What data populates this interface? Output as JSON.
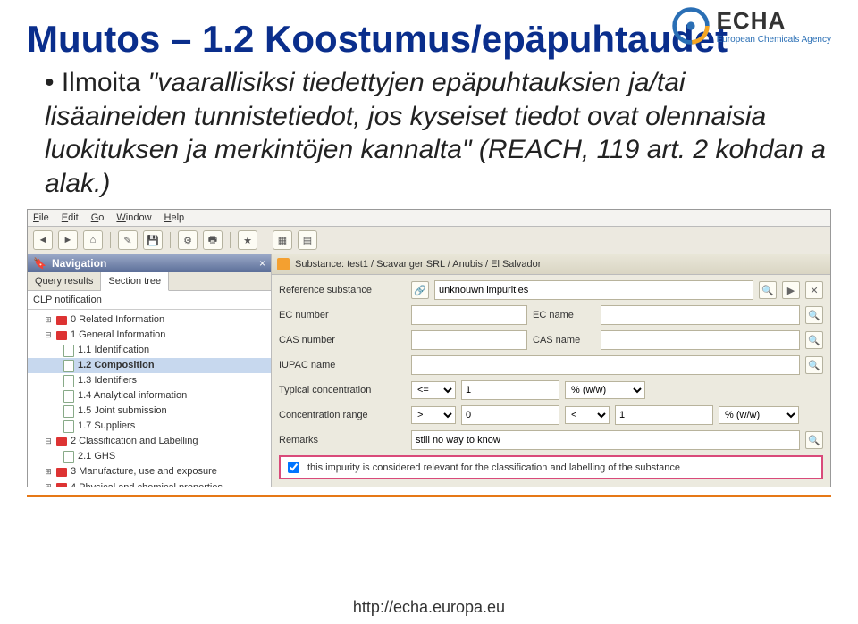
{
  "logo": {
    "main": "ECHA",
    "sub": "European Chemicals Agency"
  },
  "title": "Muutos – 1.2 Koostumus/epäpuhtaudet",
  "bullet_lead": "Ilmoita ",
  "bullet_quote": "\"vaarallisiksi tiedettyjen epäpuhtauksien ja/tai lisäaineiden tunnistetiedot, jos kyseiset tiedot ovat olennaisia luokituksen ja merkintöjen kannalta\" (REACH, 119 art. 2 kohdan a alak.)",
  "menu": {
    "file": "File",
    "edit": "Edit",
    "go": "Go",
    "window": "Window",
    "help": "Help"
  },
  "nav": {
    "title": "Navigation",
    "tabs": {
      "query": "Query results",
      "section": "Section tree"
    },
    "top_item": "CLP notification",
    "items": [
      {
        "t": "0 Related Information",
        "exp": "+"
      },
      {
        "t": "1 General Information",
        "exp": "−"
      },
      {
        "t": "1.1 Identification",
        "sub": true
      },
      {
        "t": "1.2 Composition",
        "sub": true,
        "sel": true
      },
      {
        "t": "1.3 Identifiers",
        "sub": true
      },
      {
        "t": "1.4 Analytical information",
        "sub": true
      },
      {
        "t": "1.5 Joint submission",
        "sub": true
      },
      {
        "t": "1.7 Suppliers",
        "sub": true
      },
      {
        "t": "2 Classification and Labelling",
        "exp": "−"
      },
      {
        "t": "2.1 GHS",
        "sub": true
      },
      {
        "t": "3 Manufacture, use and exposure",
        "exp": "+"
      },
      {
        "t": "4 Physical and chemical properties",
        "exp": "+"
      }
    ]
  },
  "crumb": "Substance: test1 / Scavanger SRL / Anubis / El Salvador",
  "form": {
    "ref_label": "Reference substance",
    "ref_value": "unknouwn impurities",
    "ec_num_label": "EC number",
    "ec_name_label": "EC name",
    "cas_num_label": "CAS number",
    "cas_name_label": "CAS name",
    "iupac_label": "IUPAC name",
    "typ_conc_label": "Typical concentration",
    "typ_op": "<=",
    "typ_val": "1",
    "typ_unit": "% (w/w)",
    "range_label": "Concentration range",
    "range_lo_op": ">",
    "range_lo_val": "0",
    "range_hi_op": "<",
    "range_hi_val": "1",
    "range_unit": "% (w/w)",
    "remarks_label": "Remarks",
    "remarks_value": "still no way to know",
    "check_label": "this impurity is considered relevant for the classification and labelling of the substance"
  },
  "footer": "http://echa.europa.eu"
}
